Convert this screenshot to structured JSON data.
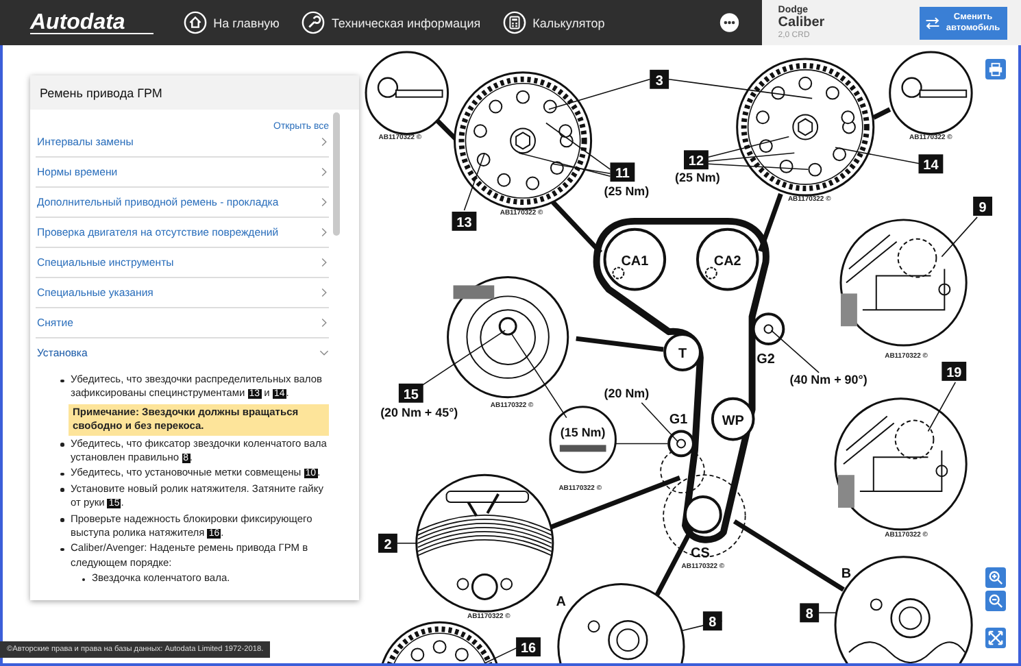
{
  "header": {
    "logo": "Autodata",
    "nav": [
      {
        "kind": "home",
        "label": "На главную"
      },
      {
        "kind": "wrench",
        "label": "Техническая информация"
      },
      {
        "kind": "calculator",
        "label": "Калькулятор"
      }
    ],
    "vehicle": {
      "make": "Dodge",
      "model": "Caliber",
      "engine": "2,0 CRD"
    },
    "change_button": "Сменить автомобиль"
  },
  "panel": {
    "title": "Ремень привода ГРМ",
    "open_all": "Открыть все",
    "sections": [
      {
        "label": "Интервалы замены",
        "expanded": false
      },
      {
        "label": "Нормы времени",
        "expanded": false
      },
      {
        "label": "Дополнительный приводной ремень - прокладка",
        "expanded": false
      },
      {
        "label": "Проверка двигателя на отсутствие повреждений",
        "expanded": false
      },
      {
        "label": "Специальные инструменты",
        "expanded": false
      },
      {
        "label": "Специальные указания",
        "expanded": false
      },
      {
        "label": "Снятие",
        "expanded": false
      },
      {
        "label": "Установка",
        "expanded": true
      }
    ],
    "steps": [
      {
        "kind": "item",
        "parts": [
          {
            "kind": "text",
            "text": "Убедитесь, что звездочки распределительных валов зафиксированы специнструментами "
          },
          {
            "kind": "ref",
            "text": "13"
          },
          {
            "kind": "text",
            "text": " и "
          },
          {
            "kind": "ref",
            "text": "14"
          },
          {
            "kind": "text",
            "text": "."
          }
        ]
      },
      {
        "kind": "note",
        "parts": [
          {
            "kind": "text",
            "text": "Примечание: Звездочки должны вращаться свободно и без перекоса."
          }
        ]
      },
      {
        "kind": "item",
        "parts": [
          {
            "kind": "text",
            "text": "Убедитесь, что фиксатор звездочки коленчатого вала установлен правильно "
          },
          {
            "kind": "ref",
            "text": "8"
          },
          {
            "kind": "text",
            "text": "."
          }
        ]
      },
      {
        "kind": "item",
        "parts": [
          {
            "kind": "text",
            "text": "Убедитесь, что установочные метки совмещены "
          },
          {
            "kind": "ref",
            "text": "10"
          },
          {
            "kind": "text",
            "text": "."
          }
        ]
      },
      {
        "kind": "item",
        "parts": [
          {
            "kind": "text",
            "text": "Установите новый ролик натяжителя. Затяните гайку от руки "
          },
          {
            "kind": "ref",
            "text": "15"
          },
          {
            "kind": "text",
            "text": "."
          }
        ]
      },
      {
        "kind": "item",
        "parts": [
          {
            "kind": "text",
            "text": "Проверьте надежность блокировки фиксирующего выступа ролика натяжителя "
          },
          {
            "kind": "ref",
            "text": "16"
          },
          {
            "kind": "text",
            "text": "."
          }
        ]
      },
      {
        "kind": "item",
        "parts": [
          {
            "kind": "text",
            "text": "Caliber/Avenger: Наденьте ремень привода ГРМ в следующем порядке:"
          }
        ],
        "children": [
          "Звездочка коленчатого вала."
        ]
      }
    ]
  },
  "diagram": {
    "callouts": [
      "3",
      "11",
      "12",
      "13",
      "14",
      "9",
      "15",
      "19",
      "2",
      "8",
      "8",
      "16"
    ],
    "torques": [
      "(25 Nm)",
      "(25 Nm)",
      "(20 Nm + 45°)",
      "(20 Nm)",
      "(15 Nm)",
      "(40 Nm + 90°)"
    ],
    "pulleys": [
      "CA1",
      "CA2",
      "T",
      "G2",
      "WP",
      "G1",
      "CS"
    ],
    "letters": [
      "A",
      "B"
    ],
    "captions": [
      "AB1170322 ©",
      "AB1170322 ©",
      "AB1170322 ©",
      "AB1170322 ©",
      "AB1170322 ©",
      "AB1170322 ©",
      "AB1170322 ©",
      "AB1170322 ©",
      "AB1170322 ©",
      "AB1170322 ©"
    ]
  },
  "copyright": "©Авторские права и права на базы данных: Autodata Limited 1972-2018."
}
